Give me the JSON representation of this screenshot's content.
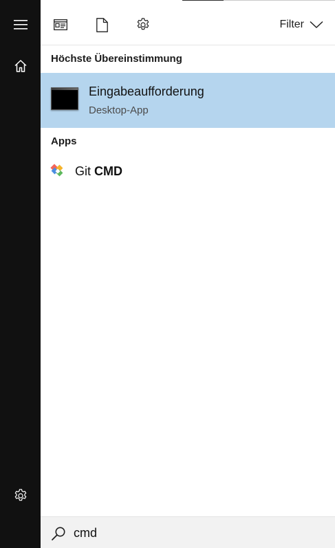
{
  "rail": {
    "menu_icon": "hamburger-icon",
    "home_icon": "home-icon",
    "settings_icon": "gear-icon"
  },
  "toolbar": {
    "apps_icon": "app-window-icon",
    "documents_icon": "document-icon",
    "settings_icon": "gear-icon",
    "filter_label": "Filter",
    "filter_icon": "chevron-down-icon"
  },
  "sections": {
    "best_match_heading": "Höchste Übereinstimmung",
    "apps_heading": "Apps"
  },
  "best_match": {
    "title": "Eingabeaufforderung",
    "subtitle": "Desktop-App",
    "icon": "command-prompt-icon",
    "highlight_color": "#b5d5ee"
  },
  "apps": [
    {
      "name_prefix": "Git ",
      "name_match": "CMD",
      "icon": "git-icon"
    }
  ],
  "search": {
    "value": "cmd",
    "icon": "search-icon"
  },
  "colors": {
    "rail_background": "#111111",
    "panel_background": "#ffffff",
    "search_background": "#f2f2f2"
  }
}
